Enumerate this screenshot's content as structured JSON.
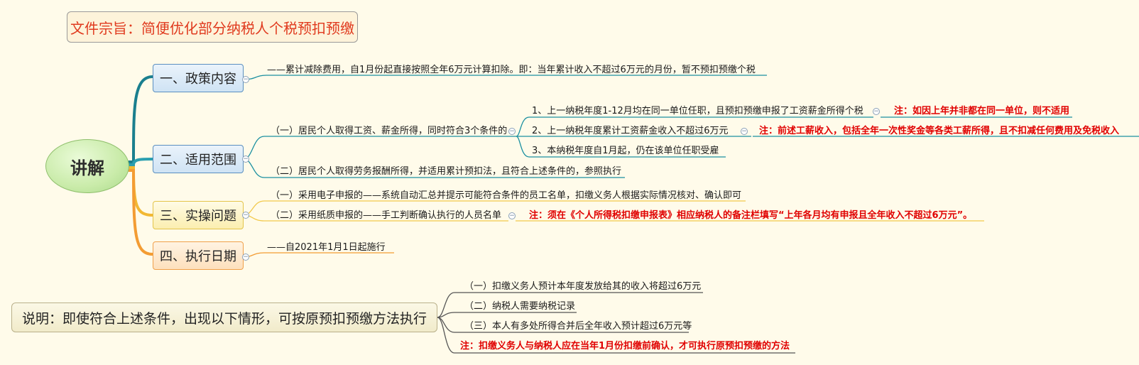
{
  "title": "文件宗旨：简便优化部分纳税人个税预扣预缴",
  "center": "讲解",
  "collapse_glyph": "−",
  "colors": {
    "teal": "#1a8fa0",
    "blue": "#4a8fd0",
    "yellow": "#f2c94c",
    "orange": "#f39c33",
    "red": "#e00000"
  },
  "branches": [
    {
      "label": "一、政策内容",
      "items": [
        "——累计减除费用，自1月份起直接按照全年6万元计算扣除。即：当年累计收入不超过6万元的月份，暂不预扣预缴个税"
      ]
    },
    {
      "label": "二、适用范围",
      "items": [
        "（一）居民个人取得工资、薪金所得，同时符合3个条件的",
        "（二）居民个人取得劳务报酬所得，并适用累计预扣法，且符合上述条件的，参照执行"
      ],
      "conditions": [
        "1、上一纳税年度1-12月均在同一单位任职，且预扣预缴申报了工资薪金所得个税",
        "2、上一纳税年度累计工资薪金收入不超过6万元",
        "3、本纳税年度自1月起，仍在该单位任职受雇"
      ],
      "condition_notes": [
        "注：如因上年并非都在同一单位，则不适用",
        "注：前述工薪收入，包括全年一次性奖金等各类工薪所得，且不扣减任何费用及免税收入"
      ]
    },
    {
      "label": "三、实操问题",
      "items": [
        "（一）采用电子申报的——系统自动汇总并提示可能符合条件的员工名单，扣缴义务人根据实际情况核对、确认即可",
        "（二）采用纸质申报的——手工判断确认执行的人员名单"
      ],
      "note": "注：须在《个人所得税扣缴申报表》相应纳税人的备注栏填写“上年各月均有申报且全年收入不超过6万元”。"
    },
    {
      "label": "四、执行日期",
      "items": [
        "——自2021年1月1日起施行"
      ]
    }
  ],
  "explanation": {
    "label": "说明：即使符合上述条件，出现以下情形，可按原预扣预缴方法执行",
    "items": [
      "（一）扣缴义务人预计本年度发放给其的收入将超过6万元",
      "（二）纳税人需要纳税记录",
      "（三）本人有多处所得合并后全年收入预计超过6万元等"
    ],
    "note": "注：扣缴义务人与纳税人应在当年1月份扣缴前确认，才可执行原预扣预缴的方法"
  }
}
